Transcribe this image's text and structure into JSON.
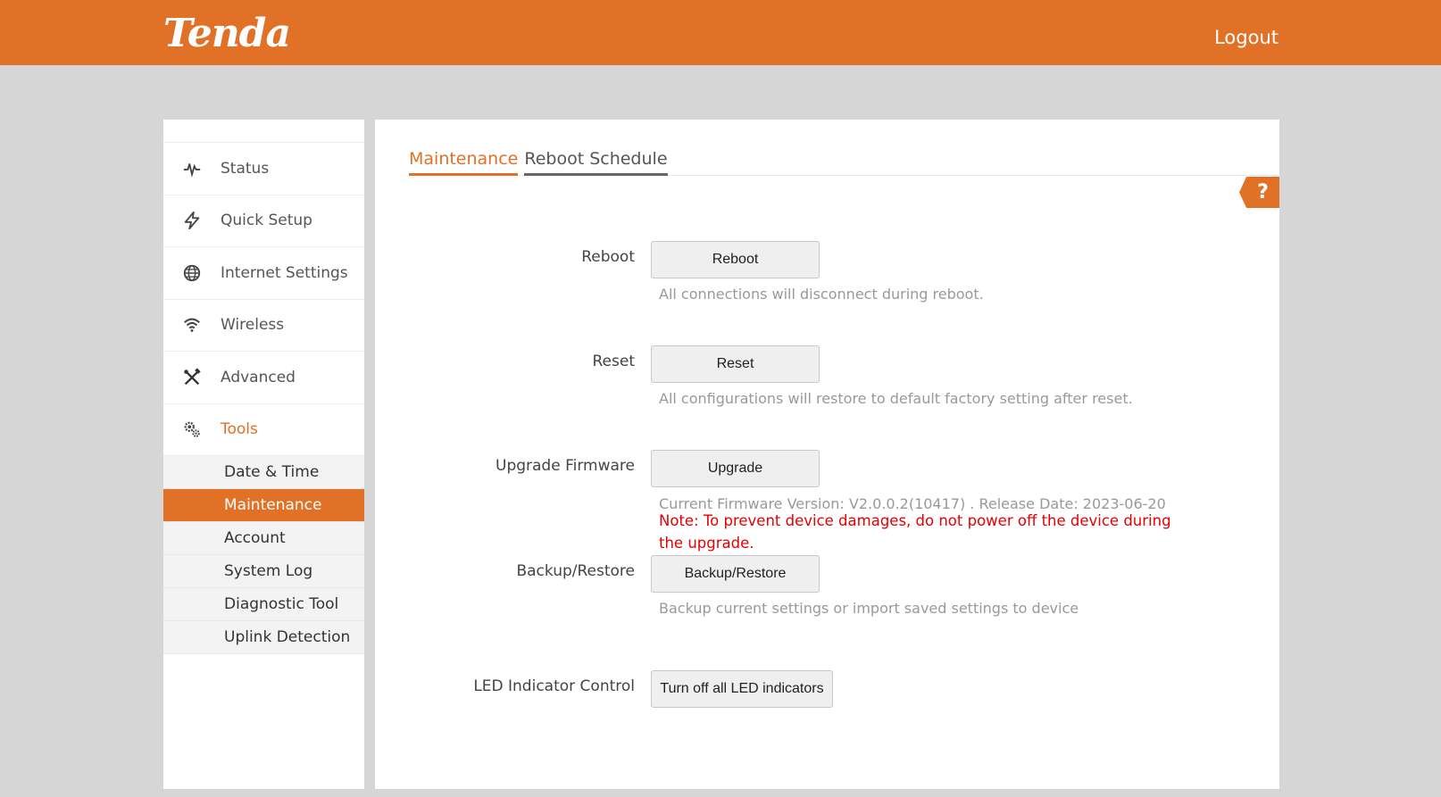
{
  "header": {
    "logo_text": "Tenda",
    "logout_label": "Logout",
    "brand_color": "#e07126"
  },
  "sidebar": {
    "items": [
      {
        "label": "Status",
        "icon": "pulse-icon"
      },
      {
        "label": "Quick Setup",
        "icon": "lightning-icon"
      },
      {
        "label": "Internet Settings",
        "icon": "globe-icon"
      },
      {
        "label": "Wireless",
        "icon": "wifi-icon"
      },
      {
        "label": "Advanced",
        "icon": "tools-cross-icon"
      },
      {
        "label": "Tools",
        "icon": "gears-icon",
        "active": true
      }
    ],
    "sub_items": [
      {
        "label": "Date & Time"
      },
      {
        "label": "Maintenance",
        "active": true
      },
      {
        "label": "Account"
      },
      {
        "label": "System Log"
      },
      {
        "label": "Diagnostic Tool"
      },
      {
        "label": "Uplink Detection"
      }
    ]
  },
  "main": {
    "tabs": [
      {
        "label": "Maintenance",
        "active": true
      },
      {
        "label": "Reboot Schedule"
      }
    ],
    "help_label": "?",
    "reboot": {
      "label": "Reboot",
      "button": "Reboot",
      "hint": "All connections will disconnect during reboot."
    },
    "reset": {
      "label": "Reset",
      "button": "Reset",
      "hint": "All configurations will restore to default factory setting after reset."
    },
    "upgrade": {
      "label": "Upgrade Firmware",
      "button": "Upgrade",
      "hint": "Current Firmware Version: V2.0.0.2(10417) . Release Date: 2023-06-20",
      "note": "Note: To prevent device damages, do not power off the device during the upgrade."
    },
    "backup": {
      "label": "Backup/Restore",
      "button": "Backup/Restore",
      "hint": "Backup current settings or import saved settings to device"
    },
    "led": {
      "label": "LED Indicator Control",
      "button": "Turn off all LED indicators"
    }
  }
}
